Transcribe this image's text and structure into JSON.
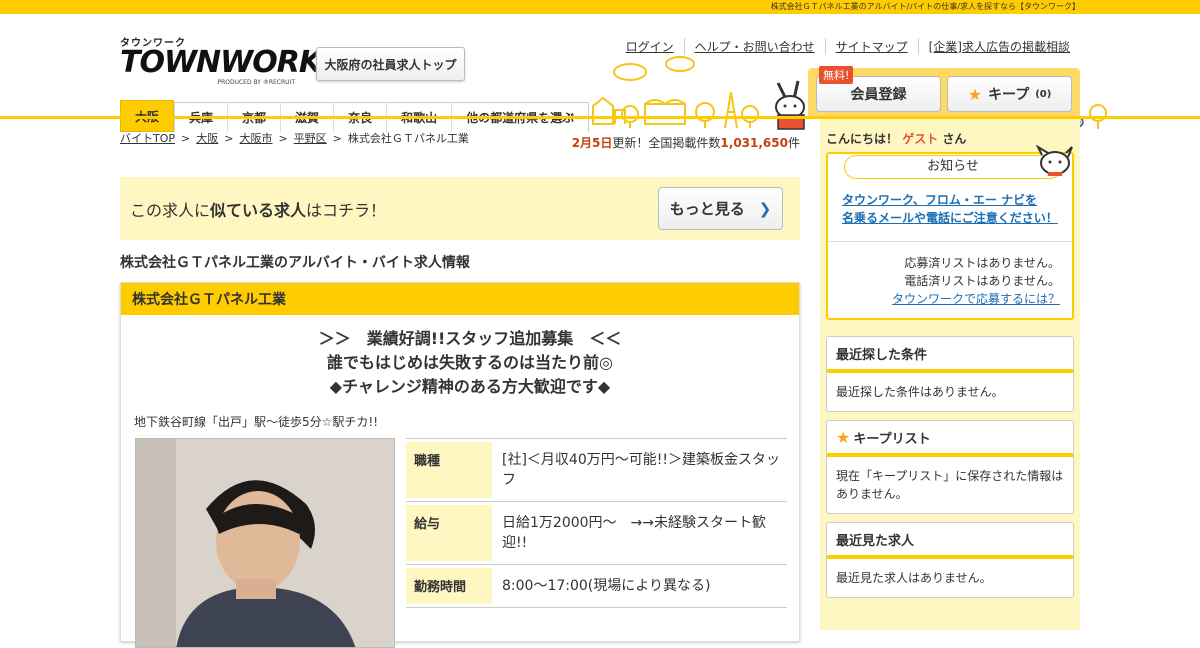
{
  "topbar": {
    "tagline": "株式会社ＧＴパネル工業のアルバイト/バイトの仕事/求人を探すなら【タウンワーク】"
  },
  "logo": {
    "kana": "タウンワーク",
    "main": "TOWNWORK",
    "sub": "PRODUCED BY ®RECRUIT"
  },
  "header": {
    "osaka_top_button": "大阪府の社員求人トップ",
    "links": [
      "ログイン",
      "ヘルプ・お問い合わせ",
      "サイトマップ",
      "[企業]求人広告の掲載相談"
    ],
    "free_tag": "無料!",
    "register_button": "会員登録",
    "keep_button": "キープ",
    "keep_count": "(0)"
  },
  "nav": {
    "tabs": [
      "大阪",
      "兵庫",
      "京都",
      "滋賀",
      "奈良",
      "和歌山",
      "他の都道府県を選ぶ"
    ],
    "active": "大阪"
  },
  "breadcrumbs": [
    "バイトTOP",
    "大阪",
    "大阪市",
    "平野区",
    "株式会社ＧＴパネル工業"
  ],
  "update": {
    "date": "2月5日",
    "text1": "更新！全国掲載件数",
    "count": "1,031,650",
    "unit": "件"
  },
  "similar": {
    "pre": "この求人に",
    "bold": "似ている求人",
    "post": "はコチラ！",
    "button": "もっと見る"
  },
  "page_title": "株式会社ＧＴパネル工業のアルバイト・バイト求人情報",
  "job": {
    "company": "株式会社ＧＴパネル工業",
    "catch": [
      "＞＞　業績好調!!スタッフ追加募集　＜＜",
      "誰でもはじめは失敗するのは当たり前◎",
      "◆チャレンジ精神のある方大歓迎です◆"
    ],
    "access": "地下鉄谷町線「出戸」駅～徒歩5分☆駅チカ!!",
    "rows": [
      {
        "key": "職種",
        "value": "[社]＜月収40万円～可能!!＞建築板金スタッフ"
      },
      {
        "key": "給与",
        "value": "日給1万2000円～　→→未経験スタート歓迎!!"
      },
      {
        "key": "勤務時間",
        "value": "8:00～17:00(現場により異なる)"
      }
    ]
  },
  "sidebar": {
    "hello_pre": "こんにちは！",
    "guest": "ゲスト",
    "hello_post": "さん",
    "news_title": "お知らせ",
    "news_link1": "タウンワーク、フロム・エー ナビを",
    "news_link2": "名乗るメールや電話にご注意ください！",
    "info1": "応募済リストはありません。",
    "info2": "電話済リストはありません。",
    "info_link": "タウンワークで応募するには？",
    "recent_search_title": "最近探した条件",
    "recent_search_body": "最近探した条件はありません。",
    "keep_list_title": "キープリスト",
    "keep_list_body": "現在「キープリスト」に保存された情報はありません。",
    "recent_view_title": "最近見た求人",
    "recent_view_body": "最近見た求人はありません。"
  },
  "colors": {
    "brand_yellow": "#ffcc00",
    "pale_yellow": "#fff7c2",
    "accent_orange": "#e8502e",
    "link_blue": "#1a6fb5"
  }
}
